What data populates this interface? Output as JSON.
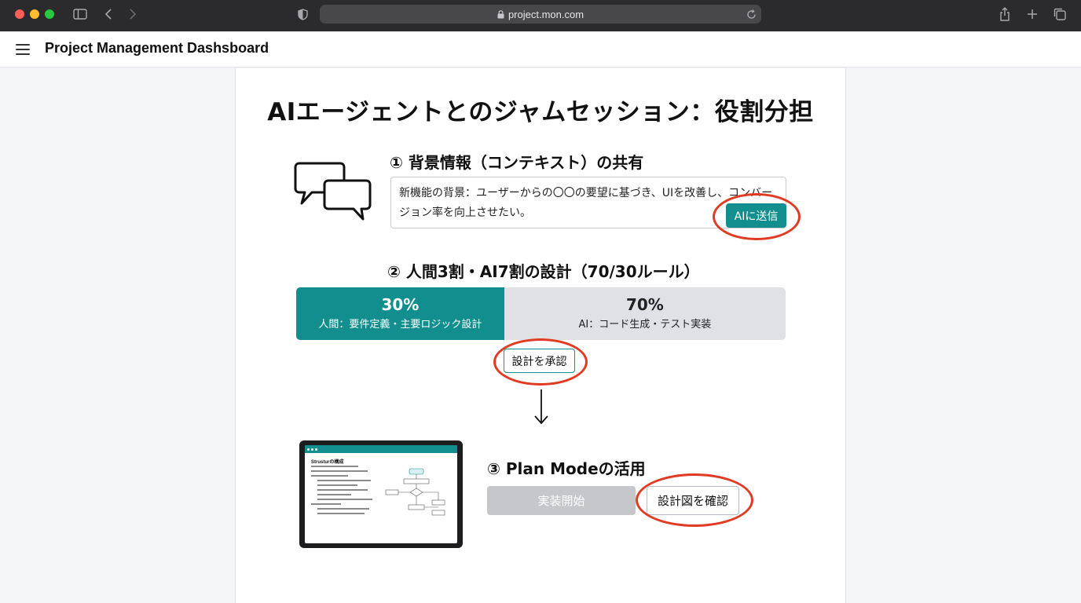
{
  "browser": {
    "url": "project.mon.com"
  },
  "app": {
    "title": "Project Management Dashsboard"
  },
  "main": {
    "title": "AIエージェントとのジャムセッション：役割分担"
  },
  "section1": {
    "heading": "① 背景情報（コンテキスト）の共有",
    "textarea_value": "新機能の背景：ユーザーからの〇〇の要望に基づき、UIを改善し、コンバージョン率を向上させたい。",
    "send_button": "AIに送信"
  },
  "section2": {
    "heading": "② 人間3割・AI7割の設計（70/30ルール）",
    "human_share": {
      "percent": "30%",
      "description": "人間：要件定義・主要ロジック設計"
    },
    "ai_share": {
      "percent": "70%",
      "description": "AI：コード生成・テスト実装"
    },
    "approve_button": "設計を承認"
  },
  "section3": {
    "heading": "③ Plan Modeの活用",
    "tablet_title": "Strusturの構成",
    "implement_button": "実装開始",
    "confirm_button": "設計図を確認"
  },
  "colors": {
    "accent": "#138e8e",
    "highlight_ring": "#e23a22",
    "disabled_button": "#c5c7cb"
  }
}
